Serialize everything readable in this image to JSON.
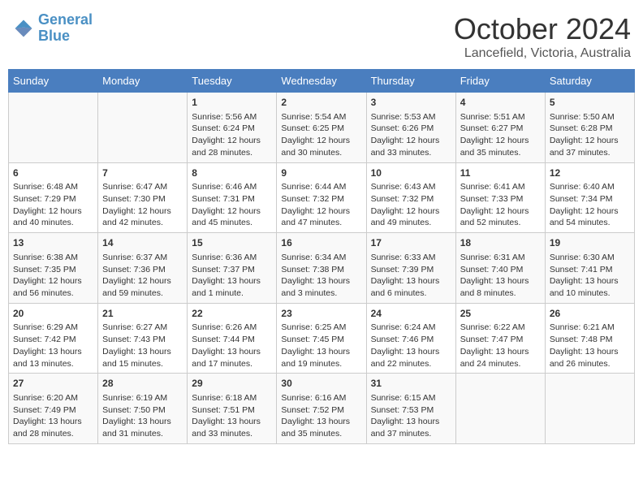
{
  "header": {
    "logo_line1": "General",
    "logo_line2": "Blue",
    "month": "October 2024",
    "location": "Lancefield, Victoria, Australia"
  },
  "weekdays": [
    "Sunday",
    "Monday",
    "Tuesday",
    "Wednesday",
    "Thursday",
    "Friday",
    "Saturday"
  ],
  "weeks": [
    [
      {
        "day": "",
        "info": ""
      },
      {
        "day": "",
        "info": ""
      },
      {
        "day": "1",
        "info": "Sunrise: 5:56 AM\nSunset: 6:24 PM\nDaylight: 12 hours and 28 minutes."
      },
      {
        "day": "2",
        "info": "Sunrise: 5:54 AM\nSunset: 6:25 PM\nDaylight: 12 hours and 30 minutes."
      },
      {
        "day": "3",
        "info": "Sunrise: 5:53 AM\nSunset: 6:26 PM\nDaylight: 12 hours and 33 minutes."
      },
      {
        "day": "4",
        "info": "Sunrise: 5:51 AM\nSunset: 6:27 PM\nDaylight: 12 hours and 35 minutes."
      },
      {
        "day": "5",
        "info": "Sunrise: 5:50 AM\nSunset: 6:28 PM\nDaylight: 12 hours and 37 minutes."
      }
    ],
    [
      {
        "day": "6",
        "info": "Sunrise: 6:48 AM\nSunset: 7:29 PM\nDaylight: 12 hours and 40 minutes."
      },
      {
        "day": "7",
        "info": "Sunrise: 6:47 AM\nSunset: 7:30 PM\nDaylight: 12 hours and 42 minutes."
      },
      {
        "day": "8",
        "info": "Sunrise: 6:46 AM\nSunset: 7:31 PM\nDaylight: 12 hours and 45 minutes."
      },
      {
        "day": "9",
        "info": "Sunrise: 6:44 AM\nSunset: 7:32 PM\nDaylight: 12 hours and 47 minutes."
      },
      {
        "day": "10",
        "info": "Sunrise: 6:43 AM\nSunset: 7:32 PM\nDaylight: 12 hours and 49 minutes."
      },
      {
        "day": "11",
        "info": "Sunrise: 6:41 AM\nSunset: 7:33 PM\nDaylight: 12 hours and 52 minutes."
      },
      {
        "day": "12",
        "info": "Sunrise: 6:40 AM\nSunset: 7:34 PM\nDaylight: 12 hours and 54 minutes."
      }
    ],
    [
      {
        "day": "13",
        "info": "Sunrise: 6:38 AM\nSunset: 7:35 PM\nDaylight: 12 hours and 56 minutes."
      },
      {
        "day": "14",
        "info": "Sunrise: 6:37 AM\nSunset: 7:36 PM\nDaylight: 12 hours and 59 minutes."
      },
      {
        "day": "15",
        "info": "Sunrise: 6:36 AM\nSunset: 7:37 PM\nDaylight: 13 hours and 1 minute."
      },
      {
        "day": "16",
        "info": "Sunrise: 6:34 AM\nSunset: 7:38 PM\nDaylight: 13 hours and 3 minutes."
      },
      {
        "day": "17",
        "info": "Sunrise: 6:33 AM\nSunset: 7:39 PM\nDaylight: 13 hours and 6 minutes."
      },
      {
        "day": "18",
        "info": "Sunrise: 6:31 AM\nSunset: 7:40 PM\nDaylight: 13 hours and 8 minutes."
      },
      {
        "day": "19",
        "info": "Sunrise: 6:30 AM\nSunset: 7:41 PM\nDaylight: 13 hours and 10 minutes."
      }
    ],
    [
      {
        "day": "20",
        "info": "Sunrise: 6:29 AM\nSunset: 7:42 PM\nDaylight: 13 hours and 13 minutes."
      },
      {
        "day": "21",
        "info": "Sunrise: 6:27 AM\nSunset: 7:43 PM\nDaylight: 13 hours and 15 minutes."
      },
      {
        "day": "22",
        "info": "Sunrise: 6:26 AM\nSunset: 7:44 PM\nDaylight: 13 hours and 17 minutes."
      },
      {
        "day": "23",
        "info": "Sunrise: 6:25 AM\nSunset: 7:45 PM\nDaylight: 13 hours and 19 minutes."
      },
      {
        "day": "24",
        "info": "Sunrise: 6:24 AM\nSunset: 7:46 PM\nDaylight: 13 hours and 22 minutes."
      },
      {
        "day": "25",
        "info": "Sunrise: 6:22 AM\nSunset: 7:47 PM\nDaylight: 13 hours and 24 minutes."
      },
      {
        "day": "26",
        "info": "Sunrise: 6:21 AM\nSunset: 7:48 PM\nDaylight: 13 hours and 26 minutes."
      }
    ],
    [
      {
        "day": "27",
        "info": "Sunrise: 6:20 AM\nSunset: 7:49 PM\nDaylight: 13 hours and 28 minutes."
      },
      {
        "day": "28",
        "info": "Sunrise: 6:19 AM\nSunset: 7:50 PM\nDaylight: 13 hours and 31 minutes."
      },
      {
        "day": "29",
        "info": "Sunrise: 6:18 AM\nSunset: 7:51 PM\nDaylight: 13 hours and 33 minutes."
      },
      {
        "day": "30",
        "info": "Sunrise: 6:16 AM\nSunset: 7:52 PM\nDaylight: 13 hours and 35 minutes."
      },
      {
        "day": "31",
        "info": "Sunrise: 6:15 AM\nSunset: 7:53 PM\nDaylight: 13 hours and 37 minutes."
      },
      {
        "day": "",
        "info": ""
      },
      {
        "day": "",
        "info": ""
      }
    ]
  ]
}
